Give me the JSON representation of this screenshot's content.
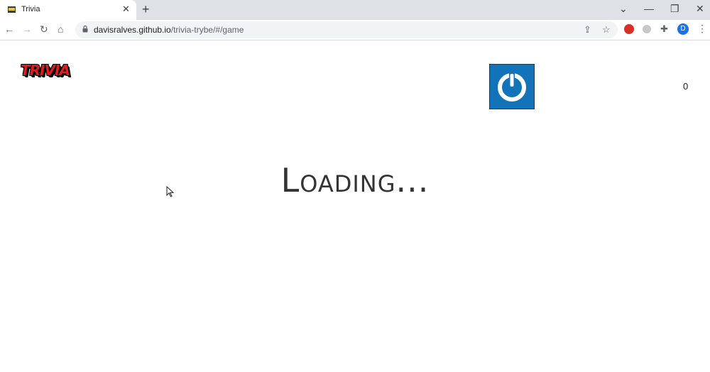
{
  "browser": {
    "tab": {
      "title": "Trivia",
      "favicon": "trivia-favicon",
      "close_icon": "✕"
    },
    "new_tab_icon": "+",
    "window": {
      "minimize": "—",
      "restore": "❐",
      "close": "✕",
      "tab_search": "⌄"
    },
    "toolbar": {
      "back_icon": "←",
      "forward_icon": "→",
      "reload_icon": "↻",
      "home_icon": "⌂",
      "url_host": "davisralves.github.io",
      "url_path": "/trivia-trybe/#/game",
      "share_icon": "⇪",
      "star_icon": "☆",
      "extension_red_icon": "●",
      "puzzle_icon": "✚",
      "profile_initial": "D",
      "menu_icon": "⋮"
    }
  },
  "header": {
    "logo_text": "TRIVIA",
    "score": "0"
  },
  "main": {
    "loading_text": "Loading..."
  },
  "colors": {
    "tabstrip": "#dee1e6",
    "avatar_bg": "#1273b9",
    "logo_red": "#e21b1b",
    "profile_blue": "#1a73e8"
  }
}
